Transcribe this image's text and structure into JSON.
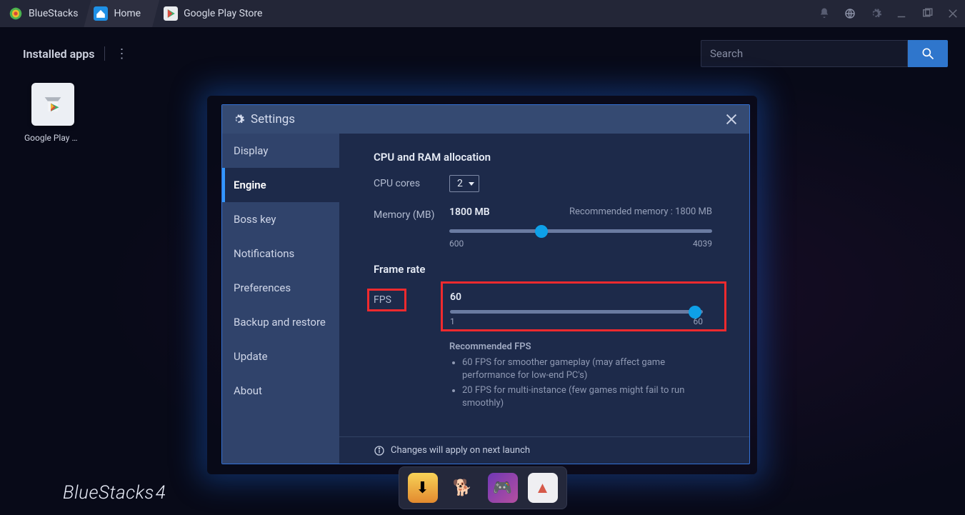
{
  "titlebar": {
    "brand": "BlueStacks",
    "tabs": [
      {
        "label": "Home"
      },
      {
        "label": "Google Play Store"
      }
    ]
  },
  "topbar": {
    "title": "Installed apps",
    "search_placeholder": "Search"
  },
  "apps": [
    {
      "name": "Google Play Store"
    }
  ],
  "settings": {
    "title": "Settings",
    "sidebar": [
      "Display",
      "Engine",
      "Boss key",
      "Notifications",
      "Preferences",
      "Backup and restore",
      "Update",
      "About"
    ],
    "active_index": 1,
    "cpu_section": "CPU and RAM allocation",
    "cpu_cores_label": "CPU cores",
    "cpu_cores_value": "2",
    "memory_label": "Memory (MB)",
    "memory_value": "1800 MB",
    "memory_rec": "Recommended memory : 1800 MB",
    "memory_min": "600",
    "memory_max": "4039",
    "memory_percent": 35,
    "frame_section": "Frame rate",
    "fps_label": "FPS",
    "fps_value": "60",
    "fps_min": "1",
    "fps_max": "60",
    "fps_percent": 97,
    "rec_title": "Recommended FPS",
    "rec_items": [
      "60 FPS for smoother gameplay (may affect game performance for low-end PC's)",
      "20 FPS for multi-instance (few games might fail to run smoothly)"
    ],
    "footer_note": "Changes will apply on next launch"
  },
  "footer_brand": "BlueStacks",
  "footer_brand_ver": "4"
}
